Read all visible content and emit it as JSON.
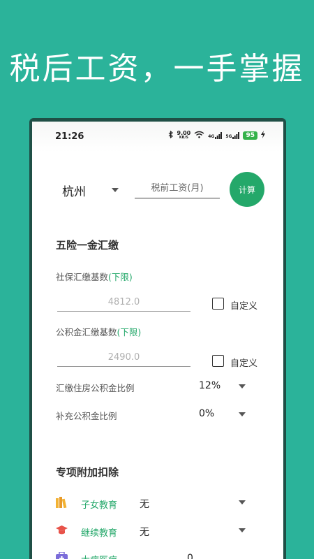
{
  "headline": "税后工资，一手掌握",
  "status_bar": {
    "time": "21:26",
    "net_speed_value": "9.00",
    "net_speed_unit": "KB/S",
    "signal_1": "4G",
    "signal_2": "5G",
    "battery": "95"
  },
  "top": {
    "city": "杭州",
    "salary_placeholder": "税前工资(月)",
    "calc_label": "计算"
  },
  "insurance": {
    "title": "五险一金汇缴",
    "social_label": "社保汇缴基数",
    "social_hint": "(下限)",
    "social_value": "4812.0",
    "social_custom": "自定义",
    "fund_label": "公积金汇缴基数",
    "fund_hint": "(下限)",
    "fund_value": "2490.0",
    "fund_custom": "自定义",
    "housing_ratio_label": "汇缴住房公积金比例",
    "housing_ratio_value": "12%",
    "extra_ratio_label": "补充公积金比例",
    "extra_ratio_value": "0%"
  },
  "deduction": {
    "title": "专项附加扣除",
    "items": [
      {
        "label": "子女教育",
        "value": "无",
        "icon": "books-icon"
      },
      {
        "label": "继续教育",
        "value": "无",
        "icon": "graduation-cap-icon"
      },
      {
        "label": "大病医疗",
        "value": "0",
        "icon": "medical-kit-icon"
      }
    ]
  }
}
